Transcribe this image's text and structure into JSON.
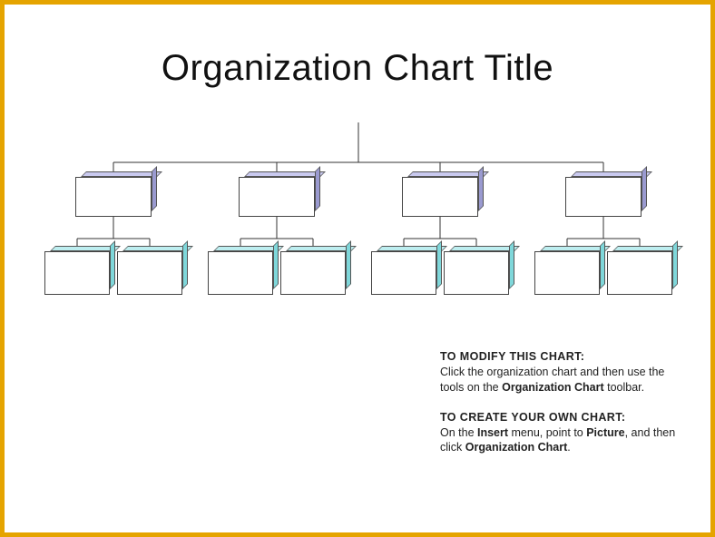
{
  "title": "Organization Chart Title",
  "instructions": {
    "modify": {
      "heading": "TO MODIFY THIS CHART:",
      "lead": "Click the organization chart and then use the tools on the ",
      "bold1": "Organization Chart",
      "tail": " toolbar."
    },
    "create": {
      "heading": "TO CREATE YOUR OWN CHART:",
      "lead": "On the ",
      "bold1": "Insert",
      "mid1": " menu, point to ",
      "bold2": "Picture",
      "mid2": ", and then click ",
      "bold3": "Organization Chart",
      "tail": "."
    }
  },
  "chart_data": {
    "type": "org-chart",
    "levels": 3,
    "root": {
      "label": "",
      "children": 4
    },
    "level2_count": 4,
    "level3_per_parent": 2,
    "colors": {
      "level2_top": "#c9c9ef",
      "level2_side": "#9a9ad0",
      "level3_top": "#bdeef0",
      "level3_side": "#7fd7da",
      "front": "#ffffff",
      "border": "#444444"
    }
  }
}
